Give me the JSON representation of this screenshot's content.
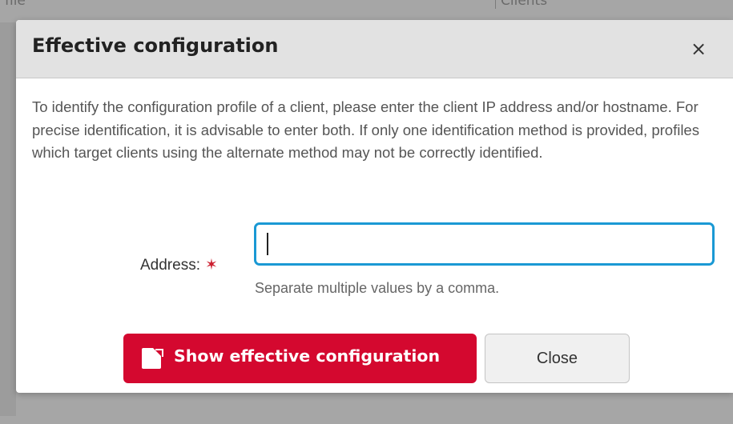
{
  "background": {
    "header_left": "file",
    "header_right": "Clients"
  },
  "dialog": {
    "title": "Effective configuration",
    "close_icon": "×",
    "description": "To identify the configuration profile of a client, please enter the client IP address and/or hostname. For precise identification, it is advisable to enter both. If only one identification method is provided, profiles which target clients using the alternate method may not be correctly identified.",
    "address_label": "Address:",
    "required_marker": "✶",
    "address_value": "",
    "address_help": "Separate multiple values by a comma.",
    "primary_button_label": "Show effective configuration",
    "primary_button_icon": "external-window-icon",
    "secondary_button_label": "Close"
  },
  "colors": {
    "primary": "#d4082f",
    "input_focus": "#1a99d4",
    "required": "#cc1f2f",
    "header_bg": "#e2e2e2"
  }
}
